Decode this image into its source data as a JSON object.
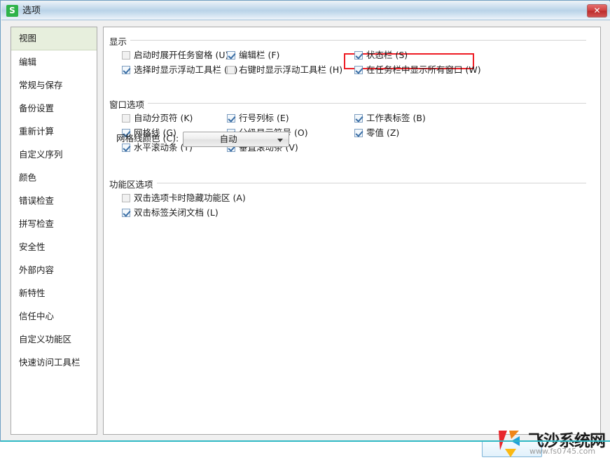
{
  "window": {
    "title": "选项",
    "app_icon": "S",
    "app_icon_color": "#2eb34a",
    "close_label": "✕"
  },
  "sidebar": {
    "items": [
      {
        "label": "视图",
        "selected": true
      },
      {
        "label": "编辑",
        "selected": false
      },
      {
        "label": "常规与保存",
        "selected": false
      },
      {
        "label": "备份设置",
        "selected": false
      },
      {
        "label": "重新计算",
        "selected": false
      },
      {
        "label": "自定义序列",
        "selected": false
      },
      {
        "label": "颜色",
        "selected": false
      },
      {
        "label": "错误检查",
        "selected": false
      },
      {
        "label": "拼写检查",
        "selected": false
      },
      {
        "label": "安全性",
        "selected": false
      },
      {
        "label": "外部内容",
        "selected": false
      },
      {
        "label": "新特性",
        "selected": false
      },
      {
        "label": "信任中心",
        "selected": false
      },
      {
        "label": "自定义功能区",
        "selected": false
      },
      {
        "label": "快速访问工具栏",
        "selected": false
      }
    ]
  },
  "main": {
    "groups": [
      {
        "title": "显示",
        "checkboxes": [
          {
            "label": "启动时展开任务窗格 (U)",
            "checked": false,
            "col": 0,
            "row": 0
          },
          {
            "label": "选择时显示浮动工具栏 (D)",
            "checked": true,
            "col": 0,
            "row": 1
          },
          {
            "label": "编辑栏 (F)",
            "checked": true,
            "col": 1,
            "row": 0
          },
          {
            "label": "右键时显示浮动工具栏 (H)",
            "checked": false,
            "col": 1,
            "row": 1
          },
          {
            "label": "状态栏 (S)",
            "checked": true,
            "col": 2,
            "row": 0
          },
          {
            "label": "在任务栏中显示所有窗口 (W)",
            "checked": true,
            "col": 2,
            "row": 1,
            "highlighted": true
          }
        ]
      },
      {
        "title": "窗口选项",
        "checkboxes": [
          {
            "label": "自动分页符 (K)",
            "checked": false,
            "col": 0,
            "row": 0
          },
          {
            "label": "网格线 (G)",
            "checked": true,
            "col": 0,
            "row": 1
          },
          {
            "label": "水平滚动条 (T)",
            "checked": true,
            "col": 0,
            "row": 2
          },
          {
            "label": "行号列标 (E)",
            "checked": true,
            "col": 1,
            "row": 0
          },
          {
            "label": "分级显示符号 (O)",
            "checked": true,
            "col": 1,
            "row": 1
          },
          {
            "label": "垂直滚动条 (V)",
            "checked": true,
            "col": 1,
            "row": 2
          },
          {
            "label": "工作表标签 (B)",
            "checked": true,
            "col": 2,
            "row": 0
          },
          {
            "label": "零值 (Z)",
            "checked": true,
            "col": 2,
            "row": 1
          }
        ]
      },
      {
        "title": "功能区选项",
        "checkboxes": [
          {
            "label": "双击选项卡时隐藏功能区 (A)",
            "checked": false,
            "col": 0,
            "row": 0
          },
          {
            "label": "双击标签关闭文档 (L)",
            "checked": true,
            "col": 0,
            "row": 1
          }
        ]
      }
    ],
    "gridline_color": {
      "label": "网格线颜色 (C):",
      "value": "自动",
      "arrow_icon": "chevron-down-icon"
    }
  },
  "highlight": {
    "color": "#ee1c24",
    "target": "在任务栏中显示所有窗口 (W)"
  },
  "watermark": {
    "brand": "飞沙系统网",
    "url": "www.fs0745.com"
  }
}
